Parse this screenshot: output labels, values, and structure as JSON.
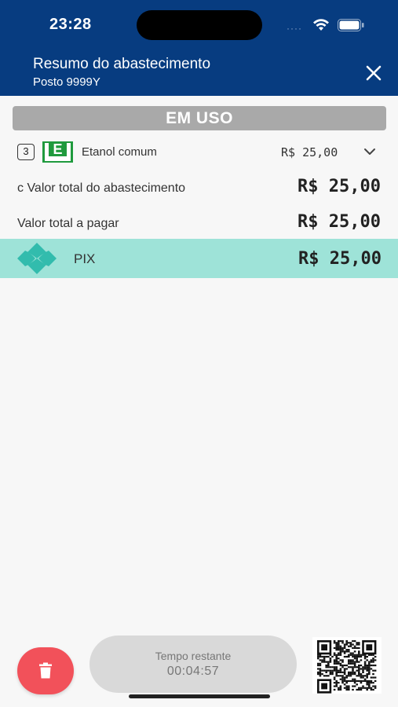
{
  "status_bar": {
    "time": "23:28",
    "dots": "····"
  },
  "header": {
    "title": "Resumo do abastecimento",
    "subtitle": "Posto 9999Y"
  },
  "status_banner": "EM USO",
  "fuel_item": {
    "pump_number": "3",
    "fuel_letter": "E",
    "fuel_name": "Etanol comum",
    "price": "R$ 25,00"
  },
  "summary": {
    "total_label": "c Valor total do abastecimento",
    "total_value": "R$ 25,00",
    "to_pay_label": "Valor total a pagar",
    "to_pay_value": "R$ 25,00"
  },
  "payment": {
    "method": "PIX",
    "value": "R$ 25,00"
  },
  "timer": {
    "label": "Tempo restante",
    "value": "00:04:57"
  },
  "colors": {
    "header_bg": "#073c80",
    "pix_row_bg": "#9ee3d8",
    "pix_logo": "#32bcad",
    "fuel_badge": "#1f9a3d",
    "delete_button": "#f2515a",
    "banner_bg": "#a9a9a9"
  }
}
